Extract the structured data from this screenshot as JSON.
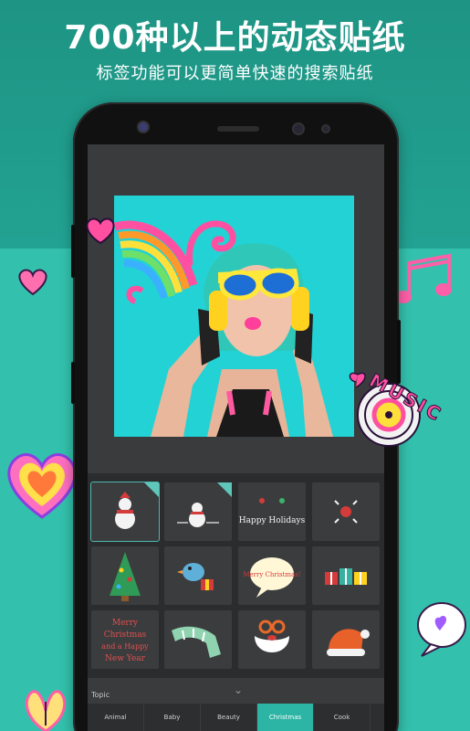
{
  "banner": {
    "headline": "700种以上的动态贴纸",
    "subline": "标签功能可以更简单快速的搜索贴纸"
  },
  "sticker_grid": {
    "tiles": [
      {
        "icon": "snowman-sticker-icon",
        "selected": true,
        "new_badge": true
      },
      {
        "icon": "snowman-greeting-sticker-icon",
        "selected": false,
        "new_badge": true
      },
      {
        "icon": "happy-holidays-sticker-icon",
        "selected": false,
        "new_badge": false
      },
      {
        "icon": "christmas-ornament-sticker-icon",
        "selected": false,
        "new_badge": false
      },
      {
        "icon": "christmas-tree-sticker-icon",
        "selected": false,
        "new_badge": false
      },
      {
        "icon": "bird-gift-sticker-icon",
        "selected": false,
        "new_badge": false
      },
      {
        "icon": "merry-christmas-bubble-sticker-icon",
        "selected": false,
        "new_badge": false
      },
      {
        "icon": "gift-boxes-sticker-icon",
        "selected": false,
        "new_badge": false
      },
      {
        "icon": "merry-christmas-text-sticker-icon",
        "selected": false,
        "new_badge": false
      },
      {
        "icon": "scarf-sticker-icon",
        "selected": false,
        "new_badge": false
      },
      {
        "icon": "santa-beard-sticker-icon",
        "selected": false,
        "new_badge": false
      },
      {
        "icon": "santa-hat-sticker-icon",
        "selected": false,
        "new_badge": false
      }
    ],
    "tile_texts": {
      "happy_holidays": "Happy Holidays",
      "merry_christmas_bubble": "Merry Christmas!",
      "merry_line1": "Merry",
      "merry_line2": "Christmas",
      "merry_line3": "and a Happy",
      "merry_line4": "New Year"
    }
  },
  "topic": {
    "label": "Topic",
    "tabs": [
      "Animal",
      "Baby",
      "Beauty",
      "Christmas",
      "Cook"
    ],
    "active_tab": "Christmas"
  },
  "decorations": {
    "music_text": "MUSIC",
    "accent_color": "#2cb4a5"
  }
}
